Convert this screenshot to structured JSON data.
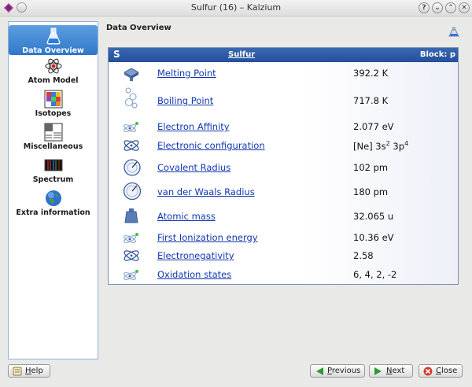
{
  "window": {
    "title": "Sulfur (16) – Kalzium",
    "buttons": [
      "?",
      "⌄",
      "⌃",
      "✕"
    ]
  },
  "sidebar": {
    "items": [
      {
        "label": "Data Overview",
        "icon": "flask-icon",
        "active": true
      },
      {
        "label": "Atom Model",
        "icon": "atom-model-icon",
        "active": false
      },
      {
        "label": "Isotopes",
        "icon": "isotopes-icon",
        "active": false
      },
      {
        "label": "Miscellaneous",
        "icon": "miscellaneous-icon",
        "active": false
      },
      {
        "label": "Spectrum",
        "icon": "spectrum-icon",
        "active": false
      },
      {
        "label": "Extra information",
        "icon": "globe-icon",
        "active": false
      }
    ]
  },
  "main": {
    "section_title": "Data Overview",
    "element": {
      "symbol": "S",
      "name": "Sulfur",
      "block": "Block: p"
    },
    "properties": [
      {
        "label": "Melting Point",
        "value": "392.2 K",
        "icon": "melting-point-icon"
      },
      {
        "label": "Boiling Point",
        "value": "717.8 K",
        "icon": "boiling-point-icon"
      },
      {
        "label": "Electron Affinity",
        "value": "2.077 eV",
        "icon": "electron-affinity-icon"
      },
      {
        "label": "Electronic configuration",
        "value_parts": [
          "[Ne] 3s",
          "2",
          " 3p",
          "4"
        ],
        "icon": "electronic-configuration-icon"
      },
      {
        "label": "Covalent Radius",
        "value": "102 pm",
        "icon": "covalent-radius-icon"
      },
      {
        "label": "van der Waals Radius",
        "value": "180 pm",
        "icon": "van-der-waals-radius-icon"
      },
      {
        "label": "Atomic mass",
        "value": "32.065 u",
        "icon": "atomic-mass-icon"
      },
      {
        "label": "First Ionization energy",
        "value": "10.36 eV",
        "icon": "ionization-energy-icon"
      },
      {
        "label": "Electronegativity",
        "value": "2.58",
        "icon": "electronegativity-icon"
      },
      {
        "label": "Oxidation states",
        "value": "6, 4, 2, -2",
        "icon": "oxidation-states-icon"
      }
    ]
  },
  "footer": {
    "help": {
      "pre": "",
      "mnemonic": "H",
      "post": "elp"
    },
    "previous": {
      "pre": "",
      "mnemonic": "P",
      "post": "revious"
    },
    "next": {
      "pre": "",
      "mnemonic": "N",
      "post": "ext"
    },
    "close": {
      "pre": "",
      "mnemonic": "C",
      "post": "lose"
    }
  },
  "colors": {
    "header_blue": "#2c5aa6",
    "link_blue": "#1238b0",
    "active_item": "#3f86d3"
  }
}
